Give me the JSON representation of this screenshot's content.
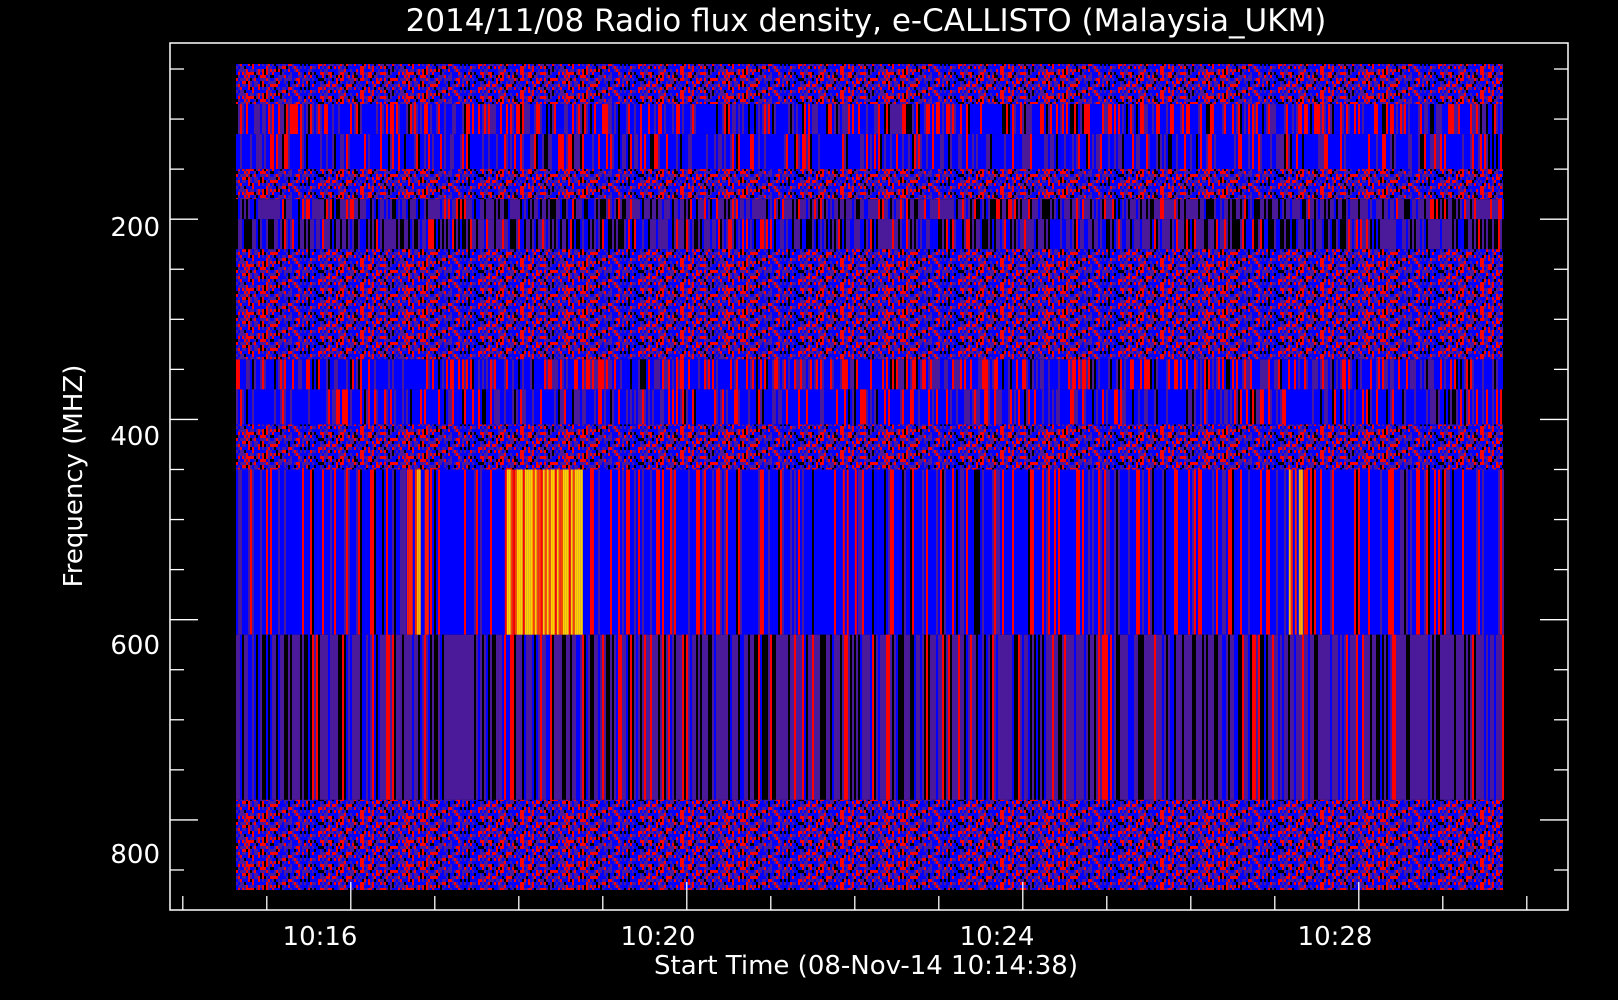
{
  "chart_data": {
    "type": "heatmap",
    "title": "2014/11/08  Radio flux density, e-CALLISTO (Malaysia_UKM)",
    "xlabel": "Start Time (08-Nov-14 10:14:38)",
    "ylabel": "Frequency (MHZ)",
    "x_range": [
      "10:14:38",
      "10:29:43"
    ],
    "y_range_mhz": [
      45,
      870
    ],
    "y_inverted": true,
    "x_ticks": [
      "10:16",
      "10:20",
      "10:24",
      "10:28"
    ],
    "y_ticks": [
      "200",
      "400",
      "600",
      "800"
    ],
    "grid": false,
    "colormap": [
      "#000000",
      "#4a1a9a",
      "#0000ff",
      "#ff0000",
      "#ffd000"
    ],
    "frequency_bands_mhz": [
      {
        "from": 45,
        "to": 85,
        "pattern": "noisy"
      },
      {
        "from": 85,
        "to": 115,
        "pattern": "streaks-red"
      },
      {
        "from": 115,
        "to": 150,
        "pattern": "blue-streaks"
      },
      {
        "from": 150,
        "to": 180,
        "pattern": "noisy"
      },
      {
        "from": 180,
        "to": 200,
        "pattern": "purple-streaks"
      },
      {
        "from": 200,
        "to": 230,
        "pattern": "dark-streaks"
      },
      {
        "from": 230,
        "to": 340,
        "pattern": "noisy"
      },
      {
        "from": 340,
        "to": 370,
        "pattern": "streaks-red"
      },
      {
        "from": 370,
        "to": 405,
        "pattern": "blue-streaks"
      },
      {
        "from": 405,
        "to": 410,
        "pattern": "noisy"
      },
      {
        "from": 410,
        "to": 450,
        "pattern": "noisy"
      },
      {
        "from": 450,
        "to": 615,
        "pattern": "bright-streaks"
      },
      {
        "from": 615,
        "to": 780,
        "pattern": "purple-streaks"
      },
      {
        "from": 780,
        "to": 870,
        "pattern": "noisy"
      }
    ],
    "bright_bursts": [
      {
        "from": "10:16:40",
        "to": "10:16:55",
        "level": "orange"
      },
      {
        "from": "10:17:50",
        "to": "10:18:45",
        "level": "yellow"
      },
      {
        "from": "10:21:50",
        "to": "10:22:00",
        "level": "red"
      },
      {
        "from": "10:27:10",
        "to": "10:27:20",
        "level": "orange"
      }
    ]
  }
}
